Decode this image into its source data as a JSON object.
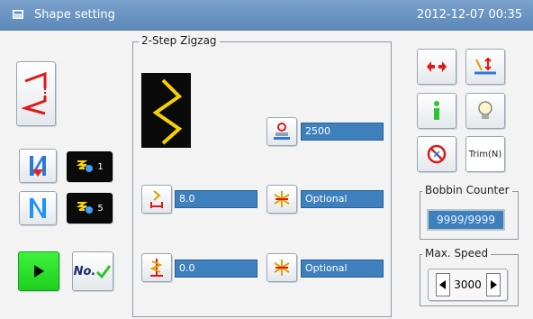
{
  "titlebar": {
    "title": "Shape setting",
    "datetime": "2012-12-07  00:35"
  },
  "left": {
    "pattern_count_1": "1",
    "pattern_count_2": "5",
    "no_label": "No."
  },
  "center": {
    "group_title": "2-Step Zigzag",
    "speed_value": "2500",
    "width_value": "8.0",
    "offset_value": "0.0",
    "option1_value": "Optional",
    "option2_value": "Optional"
  },
  "right": {
    "trim_label": "Trim(N)",
    "bobbin": {
      "title": "Bobbin Counter",
      "value": "9999/9999"
    },
    "max_speed": {
      "title": "Max. Speed",
      "value": "3000"
    }
  },
  "colors": {
    "titlebar": "#5b87b8",
    "field": "#3e7fbd",
    "play": "#2ee02e",
    "zigzag": "#f6d000"
  }
}
